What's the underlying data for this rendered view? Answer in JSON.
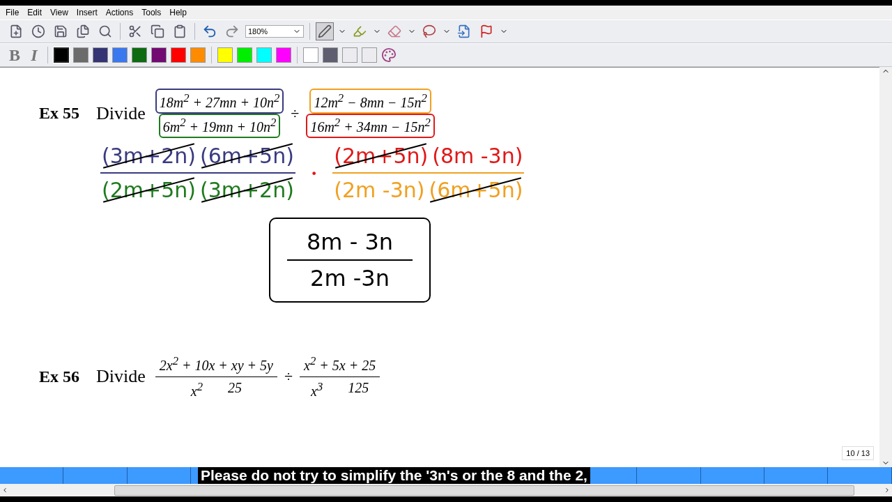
{
  "menu": [
    "File",
    "Edit",
    "View",
    "Insert",
    "Actions",
    "Tools",
    "Help"
  ],
  "zoom": {
    "value": "180%"
  },
  "pen_tools": [
    {
      "kind": "pen",
      "selected": true
    },
    {
      "kind": "highlighter",
      "selected": false
    },
    {
      "kind": "eraser",
      "selected": false
    },
    {
      "kind": "lasso",
      "selected": false
    },
    {
      "kind": "insert",
      "selected": false
    },
    {
      "kind": "flag",
      "selected": false
    }
  ],
  "format": [
    {
      "kind": "bold",
      "label": "B"
    },
    {
      "kind": "italic",
      "label": "I"
    }
  ],
  "palette": [
    {
      "color": "#000000",
      "selected": true
    },
    {
      "color": "#6b6b6b",
      "selected": false
    },
    {
      "color": "#343474",
      "selected": false
    },
    {
      "color": "#3a78f0",
      "selected": false
    },
    {
      "color": "#0e6b10",
      "selected": false
    },
    {
      "color": "#720a72",
      "selected": false
    },
    {
      "color": "#ff0000",
      "selected": false
    },
    {
      "color": "#ff8c00",
      "selected": false
    },
    {
      "color": "#ffff00",
      "selected": false
    },
    {
      "color": "#00ee00",
      "selected": false
    },
    {
      "color": "#00ffff",
      "selected": false
    },
    {
      "color": "#ff00ff",
      "selected": false
    },
    {
      "color": "#ffffff",
      "selected": false
    },
    {
      "color": "#5e5e70",
      "selected": false
    },
    {
      "color": "#ececf0",
      "selected": false
    },
    {
      "color": "#ececf0",
      "selected": false
    }
  ],
  "examples": [
    {
      "label": "Ex 55",
      "verb": "Divide",
      "left": {
        "numerator": {
          "text": "18m$^{2}$ + 27mn + 10n$^{2}$",
          "color": "#3a3a80"
        },
        "denominator": {
          "text": "6m$^{2}$ + 19mn + 10n$^{2}$",
          "color": "#1e7a1e"
        }
      },
      "operator": "÷",
      "right": {
        "numerator": {
          "text": "12m$^{2}$ − 8mn − 15n$^{2}$",
          "color": "#f0a020"
        },
        "denominator": {
          "text": "16m$^{2}$ + 34mn − 15n$^{2}$",
          "color": "#e01818"
        }
      }
    },
    {
      "label": "Ex 56",
      "verb": "Divide",
      "left": {
        "numerator": {
          "text": "2x$^{2}$ + 10x + xy + 5y"
        },
        "denominator_terms": [
          "x$^{2}$",
          "25"
        ]
      },
      "operator": "÷",
      "right": {
        "numerator": {
          "text": "x$^{2}$ + 5x + 25"
        },
        "denominator_terms": [
          "x$^{3}$",
          "125"
        ]
      }
    }
  ],
  "work": {
    "left": {
      "numerator": [
        {
          "text": "(3m+2n)",
          "color": "#3a3a80",
          "crossed": true
        },
        {
          "text": "(6m+5n)",
          "color": "#3a3a80",
          "crossed": true
        }
      ],
      "denominator": [
        {
          "text": "(2m+5n)",
          "color": "#1e7a1e",
          "crossed": true
        },
        {
          "text": "(3m+2n)",
          "color": "#1e7a1e",
          "crossed": true
        }
      ]
    },
    "operator": "·",
    "right": {
      "numerator": [
        {
          "text": "(2m+5n)",
          "color": "#e01818",
          "crossed": true
        },
        {
          "text": "(8m -3n)",
          "color": "#e01818",
          "crossed": false
        }
      ],
      "denominator": [
        {
          "text": "(2m -3n)",
          "color": "#f0a020",
          "crossed": false
        },
        {
          "text": "(6m+5n)",
          "color": "#f0a020",
          "crossed": true
        }
      ]
    }
  },
  "answer": {
    "numerator": "8m - 3n",
    "denominator": "2m -3n"
  },
  "page_counter": "10 / 13",
  "caption": "Please do not try to simplify the '3n's or the 8 and the 2,"
}
